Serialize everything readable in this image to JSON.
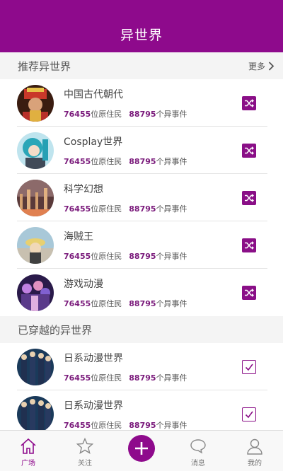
{
  "header": {
    "title": "异世界"
  },
  "recommended": {
    "title": "推荐异世界",
    "more_label": "更多",
    "items": [
      {
        "name": "中国古代朝代",
        "residents": "76455",
        "residents_suffix": "位原住民",
        "events": "88795",
        "events_suffix": "个异事件"
      },
      {
        "name": "Cosplay世界",
        "residents": "76455",
        "residents_suffix": "位原住民",
        "events": "88795",
        "events_suffix": "个异事件"
      },
      {
        "name": "科学幻想",
        "residents": "76455",
        "residents_suffix": "位原住民",
        "events": "88795",
        "events_suffix": "个异事件"
      },
      {
        "name": "海贼王",
        "residents": "76455",
        "residents_suffix": "位原住民",
        "events": "88795",
        "events_suffix": "个异事件"
      },
      {
        "name": "游戏动漫",
        "residents": "76455",
        "residents_suffix": "位原住民",
        "events": "88795",
        "events_suffix": "个异事件"
      }
    ]
  },
  "traveled": {
    "title": "已穿越的异世界",
    "items": [
      {
        "name": "日系动漫世界",
        "residents": "76455",
        "residents_suffix": "位原住民",
        "events": "88795",
        "events_suffix": "个异事件"
      },
      {
        "name": "日系动漫世界",
        "residents": "76455",
        "residents_suffix": "位原住民",
        "events": "88795",
        "events_suffix": "个异事件"
      }
    ]
  },
  "tabbar": {
    "plaza": "广场",
    "follow": "关注",
    "messages": "消息",
    "mine": "我的"
  },
  "colors": {
    "brand": "#8e0a8c",
    "number": "#7a1a7b"
  }
}
